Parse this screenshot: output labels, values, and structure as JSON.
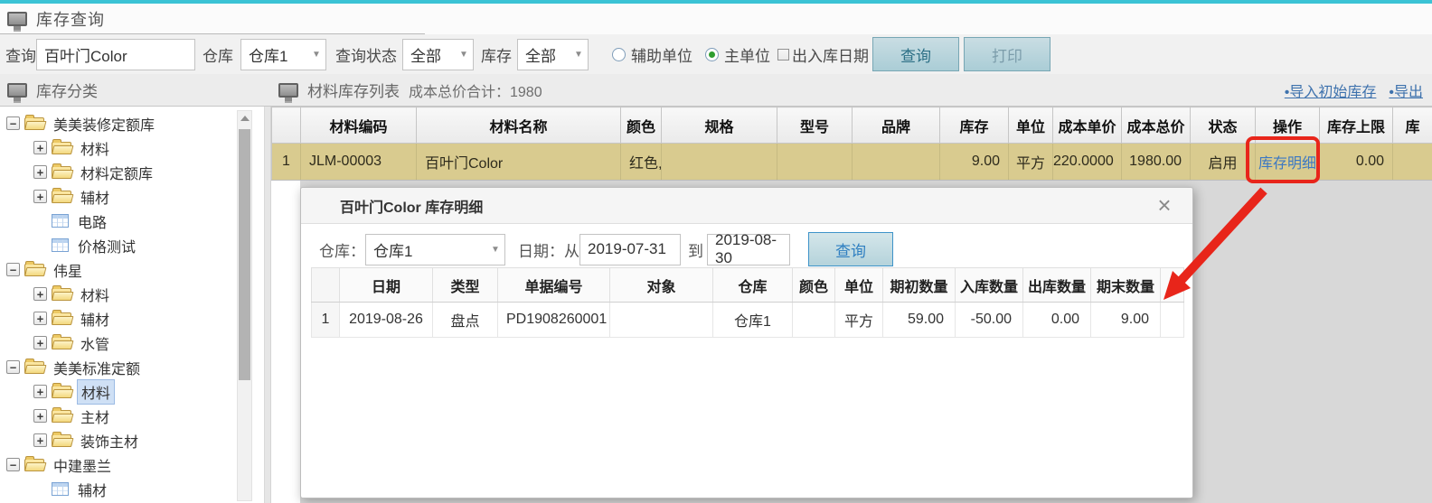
{
  "colors": {
    "accent_bar": "#3bc3d5",
    "annotation_red": "#e8251a",
    "link_blue": "#3c78c2",
    "highlight_row": "#d9cb8f",
    "radio_selected_green": "#2e9e30"
  },
  "icons": {
    "dropdown_arrow": "▼",
    "bullet": "•"
  },
  "title_bar": {
    "title": "库存查询"
  },
  "filter_bar": {
    "query_label": "查询",
    "query_value": "百叶门Color",
    "warehouse_label": "仓库",
    "warehouse_value": "仓库1",
    "status_label": "查询状态",
    "status_value": "全部",
    "stock_label": "库存",
    "stock_value": "全部",
    "unit_radio_aux": "辅助单位",
    "unit_radio_main": "主单位",
    "date_checkbox": "出入库日期",
    "search_button": "查询",
    "print_button": "打印"
  },
  "sidebar": {
    "title": "库存分类",
    "tree": [
      {
        "label": "美美装修定额库",
        "level": 0,
        "icon": "folder",
        "expander": "minus",
        "selected": false
      },
      {
        "label": "材料",
        "level": 1,
        "icon": "folder",
        "expander": "plus",
        "selected": false
      },
      {
        "label": "材料定额库",
        "level": 1,
        "icon": "folder",
        "expander": "plus",
        "selected": false
      },
      {
        "label": "辅材",
        "level": 1,
        "icon": "folder",
        "expander": "plus",
        "selected": false
      },
      {
        "label": "电路",
        "level": 1,
        "icon": "grid",
        "expander": "none",
        "selected": false
      },
      {
        "label": "价格测试",
        "level": 1,
        "icon": "grid",
        "expander": "none",
        "selected": false
      },
      {
        "label": "伟星",
        "level": 0,
        "icon": "folder",
        "expander": "minus",
        "selected": false
      },
      {
        "label": "材料",
        "level": 1,
        "icon": "folder",
        "expander": "plus",
        "selected": false
      },
      {
        "label": "辅材",
        "level": 1,
        "icon": "folder",
        "expander": "plus",
        "selected": false
      },
      {
        "label": "水管",
        "level": 1,
        "icon": "folder",
        "expander": "plus",
        "selected": false
      },
      {
        "label": "美美标准定额",
        "level": 0,
        "icon": "folder",
        "expander": "minus",
        "selected": false
      },
      {
        "label": "材料",
        "level": 1,
        "icon": "folder",
        "expander": "plus",
        "selected": true
      },
      {
        "label": "主材",
        "level": 1,
        "icon": "folder",
        "expander": "plus",
        "selected": false
      },
      {
        "label": "装饰主材",
        "level": 1,
        "icon": "folder",
        "expander": "plus",
        "selected": false
      },
      {
        "label": "中建墨兰",
        "level": 0,
        "icon": "folder",
        "expander": "minus",
        "selected": false
      },
      {
        "label": "辅材",
        "level": 1,
        "icon": "grid",
        "expander": "none",
        "selected": false
      }
    ]
  },
  "main": {
    "title": "材料库存列表",
    "total": "成本总价合计：1980",
    "links": {
      "import": "•导入初始库存",
      "export": "•导出"
    },
    "table": {
      "columns": [
        "",
        "材料编码",
        "材料名称",
        "颜色",
        "规格",
        "型号",
        "品牌",
        "库存",
        "单位",
        "成本单价",
        "成本总价",
        "状态",
        "操作",
        "库存上限",
        "库"
      ],
      "row": {
        "num": "1",
        "code": "JLM-00003",
        "name": "百叶门Color",
        "color": "红色,",
        "spec": "",
        "model": "",
        "brand": "",
        "stock": "9.00",
        "unit": "平方",
        "unit_cost": "220.0000",
        "total_cost": "1980.00",
        "status": "启用",
        "action": "库存明细",
        "upper_limit": "0.00",
        "extra": ""
      }
    }
  },
  "modal": {
    "title": "百叶门Color 库存明细",
    "close": "×",
    "filters": {
      "warehouse_label": "仓库：",
      "warehouse_value": "仓库1",
      "date_label": "日期：从",
      "date_from": "2019-07-31",
      "to_label": "到",
      "date_to": "2019-08-30",
      "search_button": "查询"
    },
    "table": {
      "columns": [
        "",
        "日期",
        "类型",
        "单据编号",
        "对象",
        "仓库",
        "颜色",
        "单位",
        "期初数量",
        "入库数量",
        "出库数量",
        "期末数量",
        ""
      ],
      "row": {
        "num": "1",
        "date": "2019-08-26",
        "type": "盘点",
        "doc_no": "PD1908260001",
        "object": "",
        "warehouse": "仓库1",
        "color": "",
        "unit": "平方",
        "opening_qty": "59.00",
        "in_qty": "-50.00",
        "out_qty": "0.00",
        "closing_qty": "9.00",
        "extra": ""
      }
    }
  }
}
